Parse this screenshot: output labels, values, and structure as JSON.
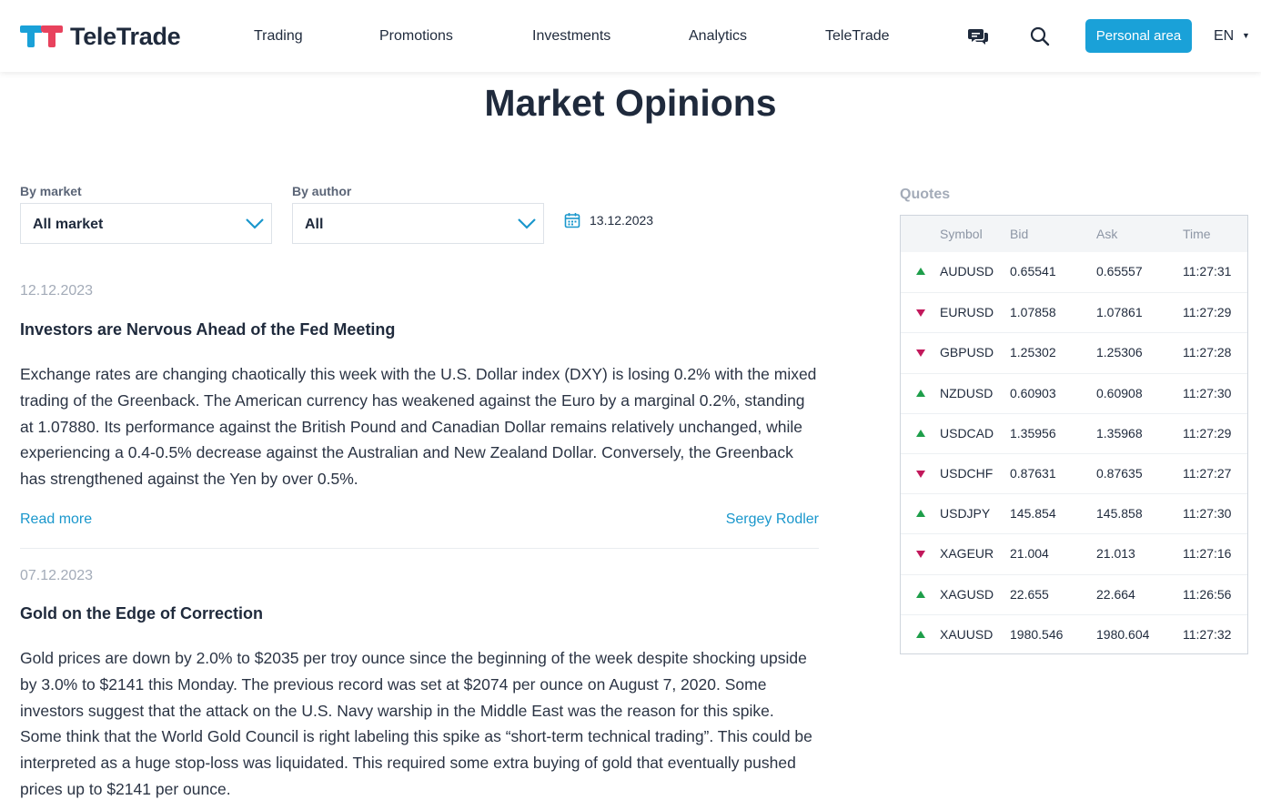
{
  "brand": {
    "name": "TeleTrade",
    "logo_colors": [
      "#1aa1d8",
      "#e8425d"
    ]
  },
  "nav": [
    {
      "label": "Trading"
    },
    {
      "label": "Promotions"
    },
    {
      "label": "Investments"
    },
    {
      "label": "Analytics"
    },
    {
      "label": "TeleTrade"
    }
  ],
  "header": {
    "chat_icon": "chat-icon",
    "search_icon": "search-icon",
    "personal_area_label": "Personal area",
    "language": "EN",
    "accent_color": "#1aa1d8"
  },
  "page": {
    "title": "Market Opinions"
  },
  "filters": {
    "market_label": "By market",
    "market_value": "All market",
    "author_label": "By author",
    "author_value": "All",
    "date_value": "13.12.2023"
  },
  "articles": [
    {
      "date": "12.12.2023",
      "title": "Investors are Nervous Ahead of the Fed Meeting",
      "body": "Exchange rates are changing chaotically this week with the U.S. Dollar index (DXY) is losing 0.2% with the mixed trading of the Greenback. The American currency has weakened against the Euro by a marginal 0.2%, standing at 1.07880. Its performance against the British Pound and Canadian Dollar remains relatively unchanged, while experiencing a 0.4-0.5% decrease against the Australian and New Zealand Dollar. Conversely, the Greenback has strengthened against the Yen by over 0.5%.",
      "read_more": "Read more",
      "author": "Sergey Rodler"
    },
    {
      "date": "07.12.2023",
      "title": "Gold on the Edge of Correction",
      "body": "Gold prices are down by 2.0% to $2035 per troy ounce since the beginning of the week despite shocking upside by 3.0% to $2141 this Monday. The previous record was set at $2074 per ounce on August 7, 2020. Some investors suggest that the attack on the U.S. Navy warship in the Middle East was the reason for this spike. Some think that the World Gold Council is right labeling this spike as “short-term technical trading”. This could be interpreted as a huge stop-loss was liquidated. This required some extra buying of gold that eventually pushed prices up to $2141 per ounce."
    }
  ],
  "quotes": {
    "label": "Quotes",
    "columns": [
      "Symbol",
      "Bid",
      "Ask",
      "Time"
    ],
    "up_color": "#1e9e4a",
    "down_color": "#c2185b",
    "rows": [
      {
        "direction": "up",
        "symbol": "AUDUSD",
        "bid": "0.65541",
        "ask": "0.65557",
        "time": "11:27:31"
      },
      {
        "direction": "down",
        "symbol": "EURUSD",
        "bid": "1.07858",
        "ask": "1.07861",
        "time": "11:27:29"
      },
      {
        "direction": "down",
        "symbol": "GBPUSD",
        "bid": "1.25302",
        "ask": "1.25306",
        "time": "11:27:28"
      },
      {
        "direction": "up",
        "symbol": "NZDUSD",
        "bid": "0.60903",
        "ask": "0.60908",
        "time": "11:27:30"
      },
      {
        "direction": "up",
        "symbol": "USDCAD",
        "bid": "1.35956",
        "ask": "1.35968",
        "time": "11:27:29"
      },
      {
        "direction": "down",
        "symbol": "USDCHF",
        "bid": "0.87631",
        "ask": "0.87635",
        "time": "11:27:27"
      },
      {
        "direction": "up",
        "symbol": "USDJPY",
        "bid": "145.854",
        "ask": "145.858",
        "time": "11:27:30"
      },
      {
        "direction": "down",
        "symbol": "XAGEUR",
        "bid": "21.004",
        "ask": "21.013",
        "time": "11:27:16"
      },
      {
        "direction": "up",
        "symbol": "XAGUSD",
        "bid": "22.655",
        "ask": "22.664",
        "time": "11:26:56"
      },
      {
        "direction": "up",
        "symbol": "XAUUSD",
        "bid": "1980.546",
        "ask": "1980.604",
        "time": "11:27:32"
      }
    ]
  }
}
